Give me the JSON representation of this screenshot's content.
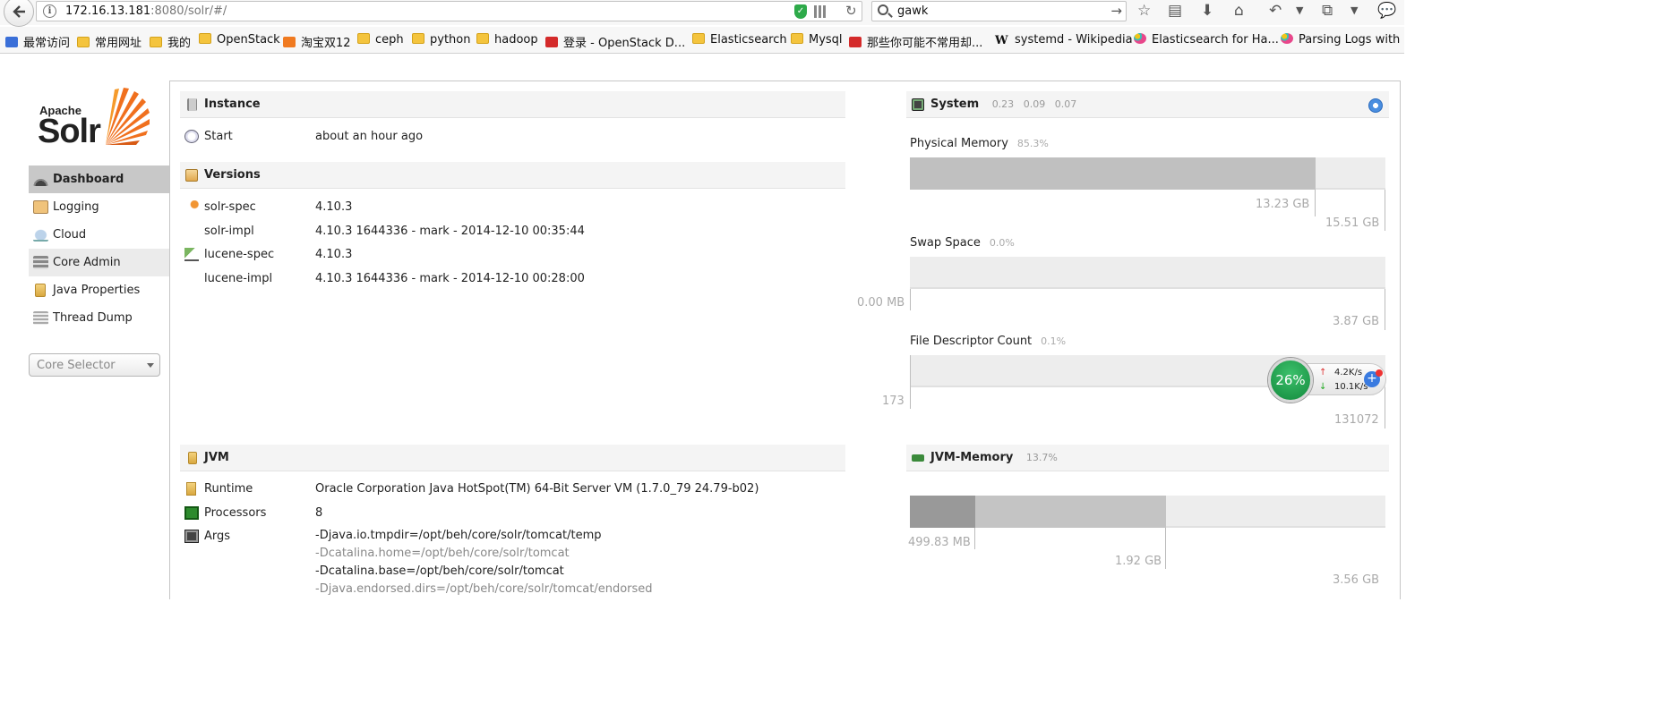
{
  "browser": {
    "url_host": "172.16.13.181",
    "url_rest": ":8080/solr/#/",
    "search_query": "gawk",
    "bookmarks": [
      {
        "label": "最常访问",
        "icon": "blue-icon"
      },
      {
        "label": "常用网址",
        "icon": "folder-icon"
      },
      {
        "label": "我的",
        "icon": "folder-icon"
      },
      {
        "label": "OpenStack",
        "icon": "folder-icon"
      },
      {
        "label": "淘宝双12",
        "icon": "orange-icon"
      },
      {
        "label": "ceph",
        "icon": "folder-icon"
      },
      {
        "label": "python",
        "icon": "folder-icon"
      },
      {
        "label": "hadoop",
        "icon": "folder-icon"
      },
      {
        "label": "登录 - OpenStack D...",
        "icon": "red-icon"
      },
      {
        "label": "Elasticsearch",
        "icon": "folder-icon"
      },
      {
        "label": "Mysql",
        "icon": "folder-icon"
      },
      {
        "label": "那些你可能不常用却...",
        "icon": "red-icon"
      },
      {
        "label": "systemd - Wikipedia",
        "icon": "w-icon"
      },
      {
        "label": "Elasticsearch for Ha...",
        "icon": "elk-icon"
      },
      {
        "label": "Parsing Logs with L",
        "icon": "elk-icon"
      }
    ]
  },
  "logo": {
    "apache": "Apache",
    "solr": "Solr"
  },
  "sidebar": {
    "items": [
      {
        "label": "Dashboard",
        "icon": "dashboard-icon"
      },
      {
        "label": "Logging",
        "icon": "logging-icon"
      },
      {
        "label": "Cloud",
        "icon": "cloud-icon"
      },
      {
        "label": "Core Admin",
        "icon": "core-admin-icon"
      },
      {
        "label": "Java Properties",
        "icon": "java-properties-icon"
      },
      {
        "label": "Thread Dump",
        "icon": "thread-dump-icon"
      }
    ],
    "core_selector": "Core Selector"
  },
  "instance": {
    "title": "Instance",
    "start_label": "Start",
    "start_value": "about an hour ago"
  },
  "versions": {
    "title": "Versions",
    "rows": [
      {
        "key": "solr-spec",
        "value": "4.10.3"
      },
      {
        "key": "solr-impl",
        "value": "4.10.3 1644336 - mark - 2014-12-10 00:35:44"
      },
      {
        "key": "lucene-spec",
        "value": "4.10.3"
      },
      {
        "key": "lucene-impl",
        "value": "4.10.3 1644336 - mark - 2014-12-10 00:28:00"
      }
    ]
  },
  "jvm": {
    "title": "JVM",
    "runtime_label": "Runtime",
    "runtime_value": "Oracle Corporation Java HotSpot(TM) 64-Bit Server VM (1.7.0_79 24.79-b02)",
    "processors_label": "Processors",
    "processors_value": "8",
    "args_label": "Args",
    "args": [
      "-Djava.io.tmpdir=/opt/beh/core/solr/tomcat/temp",
      "-Dcatalina.home=/opt/beh/core/solr/tomcat",
      "-Dcatalina.base=/opt/beh/core/solr/tomcat",
      "-Djava.endorsed.dirs=/opt/beh/core/solr/tomcat/endorsed"
    ]
  },
  "system": {
    "title": "System",
    "load": [
      "0.23",
      "0.09",
      "0.07"
    ],
    "physical_memory": {
      "label": "Physical Memory",
      "pct": "85.3%",
      "used": "13.23 GB",
      "total": "15.51 GB",
      "fraction": 0.853
    },
    "swap": {
      "label": "Swap Space",
      "pct": "0.0%",
      "used": "0.00 MB",
      "total": "3.87 GB",
      "fraction": 0.0
    },
    "fd": {
      "label": "File Descriptor Count",
      "pct": "0.1%",
      "used": "173",
      "total": "131072",
      "fraction": 0.001
    }
  },
  "jvm_memory": {
    "title": "JVM-Memory",
    "pct": "13.7%",
    "used": "499.83 MB",
    "committed": "1.92 GB",
    "max": "3.56 GB",
    "used_fraction": 0.137,
    "committed_fraction": 0.539
  },
  "net_widget": {
    "percent": "26%",
    "up": "4.2K/s",
    "down": "10.1K/s"
  },
  "colors": {
    "active_nav": "#c8c8c8",
    "bar_used": "#c0c0c0",
    "bar_track": "#ededed",
    "jvm_used": "#999999",
    "jvm_committed": "#c4c4c4"
  }
}
